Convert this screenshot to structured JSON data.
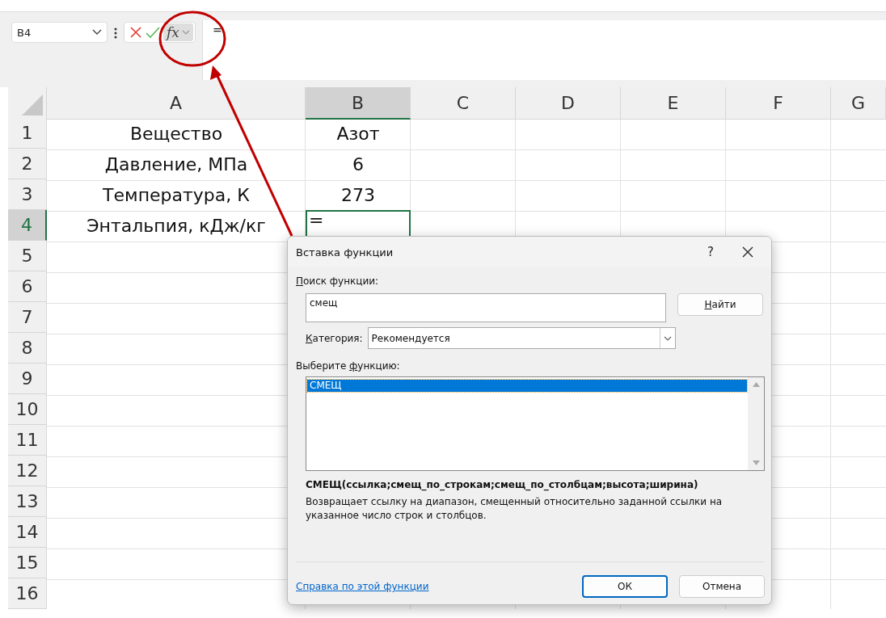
{
  "formula_bar": {
    "name_box": "B4",
    "function_button": "fx",
    "formula": "="
  },
  "columns": [
    {
      "label": "A",
      "selected": false
    },
    {
      "label": "B",
      "selected": true
    },
    {
      "label": "C",
      "selected": false
    },
    {
      "label": "D",
      "selected": false
    },
    {
      "label": "E",
      "selected": false
    },
    {
      "label": "F",
      "selected": false
    },
    {
      "label": "G",
      "selected": false
    }
  ],
  "rows": [
    {
      "number": "1",
      "selected": false,
      "cells": [
        "Вещество",
        "Азот"
      ]
    },
    {
      "number": "2",
      "selected": false,
      "cells": [
        "Давление, МПа",
        "6"
      ]
    },
    {
      "number": "3",
      "selected": false,
      "cells": [
        "Температура, К",
        "273"
      ]
    },
    {
      "number": "4",
      "selected": true,
      "cells": [
        "Энтальпия, кДж/кг",
        "="
      ]
    },
    {
      "number": "5",
      "selected": false
    },
    {
      "number": "6",
      "selected": false
    },
    {
      "number": "7",
      "selected": false
    },
    {
      "number": "8",
      "selected": false
    },
    {
      "number": "9",
      "selected": false
    },
    {
      "number": "10",
      "selected": false
    },
    {
      "number": "11",
      "selected": false
    },
    {
      "number": "12",
      "selected": false
    },
    {
      "number": "13",
      "selected": false
    },
    {
      "number": "14",
      "selected": false
    },
    {
      "number": "15",
      "selected": false
    },
    {
      "number": "16",
      "selected": false
    }
  ],
  "dialog": {
    "title": "Вставка функции",
    "help": "?",
    "search_label": {
      "key": "П",
      "after": "оиск функции:"
    },
    "search_value": "смещ",
    "find_button": {
      "key": "Н",
      "after": "айти"
    },
    "category_label": {
      "key": "К",
      "after": "атегория:"
    },
    "category_value": "Рекомендуется",
    "list_label": {
      "before": "Выберите ",
      "key": "ф",
      "after": "ункцию:"
    },
    "functions": [
      {
        "name": "СМЕЩ",
        "selected": true
      }
    ],
    "signature": "СМЕЩ(ссылка;смещ_по_строкам;смещ_по_столбцам;высота;ширина)",
    "description": "Возвращает ссылку на диапазон, смещенный относительно заданной ссылки на указанное число строк и столбцов.",
    "help_link": "Справка по этой функции",
    "ok": "ОК",
    "cancel": "Отмена"
  }
}
